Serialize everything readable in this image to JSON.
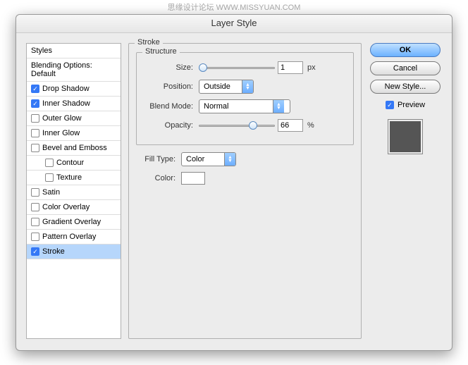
{
  "watermark": "思缘设计论坛 WWW.MISSYUAN.COM",
  "title": "Layer Style",
  "styles_header": "Styles",
  "blending_options": "Blending Options: Default",
  "items": {
    "drop_shadow": "Drop Shadow",
    "inner_shadow": "Inner Shadow",
    "outer_glow": "Outer Glow",
    "inner_glow": "Inner Glow",
    "bevel": "Bevel and Emboss",
    "contour": "Contour",
    "texture": "Texture",
    "satin": "Satin",
    "color_overlay": "Color Overlay",
    "gradient_overlay": "Gradient Overlay",
    "pattern_overlay": "Pattern Overlay",
    "stroke": "Stroke"
  },
  "panel": {
    "title": "Stroke",
    "structure_title": "Structure",
    "size_label": "Size:",
    "size_value": "1",
    "size_unit": "px",
    "position_label": "Position:",
    "position_value": "Outside",
    "blend_label": "Blend Mode:",
    "blend_value": "Normal",
    "opacity_label": "Opacity:",
    "opacity_value": "66",
    "opacity_unit": "%",
    "filltype_label": "Fill Type:",
    "filltype_value": "Color",
    "color_label": "Color:"
  },
  "buttons": {
    "ok": "OK",
    "cancel": "Cancel",
    "new_style": "New Style...",
    "preview": "Preview"
  }
}
